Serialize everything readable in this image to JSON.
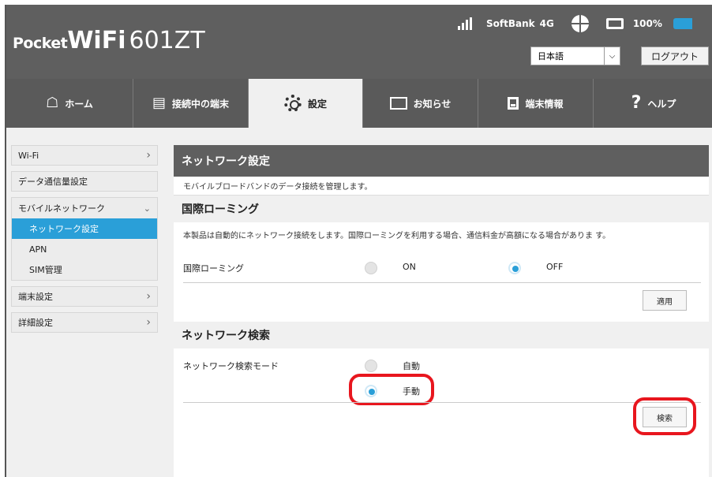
{
  "header": {
    "logo_pocket": "Pocket",
    "logo_wifi": "WiFi",
    "logo_model": "601ZT",
    "carrier": "SoftBank",
    "network": "4G",
    "battery": "100%",
    "language": "日本語",
    "logout": "ログアウト"
  },
  "nav": {
    "home": "ホーム",
    "devices": "接続中の端末",
    "settings": "設定",
    "notices": "お知らせ",
    "info": "端末情報",
    "help": "ヘルプ"
  },
  "sidebar": {
    "wifi": "Wi-Fi",
    "data": "データ通信量設定",
    "mobile": "モバイルネットワーク",
    "network_settings": "ネットワーク設定",
    "apn": "APN",
    "sim": "SIM管理",
    "device": "端末設定",
    "advanced": "詳細設定"
  },
  "main": {
    "title": "ネットワーク設定",
    "desc": "モバイルブロードバンドのデータ接続を管理します。",
    "roaming": {
      "section": "国際ローミング",
      "para": "本製品は自動的にネットワーク接続をします。国際ローミングを利用する場合、通信料金が高額になる場合がありま す。",
      "label": "国際ローミング",
      "on": "ON",
      "off": "OFF",
      "apply": "適用",
      "selected": "OFF"
    },
    "search": {
      "section": "ネットワーク検索",
      "label": "ネットワーク検索モード",
      "auto": "自動",
      "manual": "手動",
      "button": "検索",
      "selected": "手動"
    }
  },
  "colors": {
    "accent": "#2a9fd8",
    "highlight": "#e8161e",
    "header": "#5f5f5f"
  }
}
